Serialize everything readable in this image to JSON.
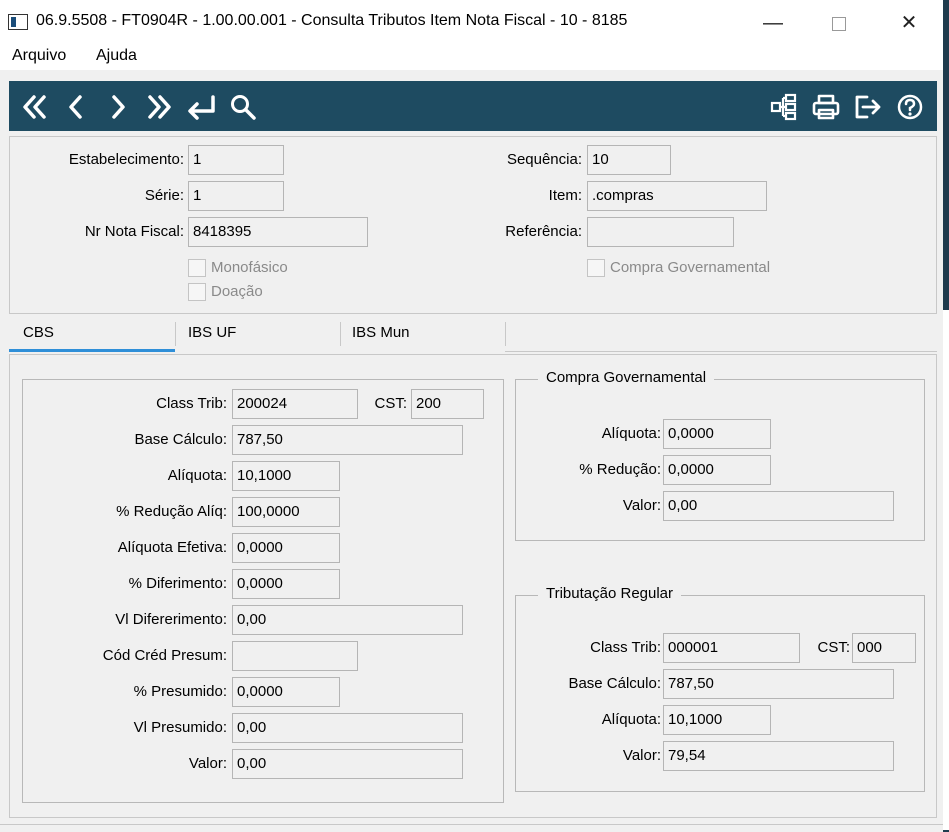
{
  "window": {
    "title": "06.9.5508 - FT0904R - 1.00.00.001 - Consulta Tributos Item Nota Fiscal - 10 - 8185",
    "minimize_glyph": "—",
    "close_glyph": "✕"
  },
  "menu": {
    "items": [
      "Arquivo",
      "Ajuda"
    ]
  },
  "toolbar": {
    "icons": [
      "first-icon",
      "previous-icon",
      "next-icon",
      "last-icon",
      "goto-icon",
      "search-icon",
      "structure-icon",
      "print-icon",
      "exit-icon",
      "help-icon"
    ]
  },
  "header": {
    "estabelecimento": {
      "label": "Estabelecimento:",
      "value": "1"
    },
    "serie": {
      "label": "Série:",
      "value": "1"
    },
    "nr_nota_fiscal": {
      "label": "Nr Nota Fiscal:",
      "value": "8418395"
    },
    "sequencia": {
      "label": "Sequência:",
      "value": "10"
    },
    "item": {
      "label": "Item:",
      "value": ".compras"
    },
    "referencia": {
      "label": "Referência:",
      "value": ""
    },
    "monofasico": {
      "label": "Monofásico",
      "checked": false
    },
    "doacao": {
      "label": "Doação",
      "checked": false
    },
    "compra_governamental": {
      "label": "Compra Governamental",
      "checked": false
    }
  },
  "tabs": [
    {
      "label": "CBS",
      "active": true
    },
    {
      "label": "IBS UF",
      "active": false
    },
    {
      "label": "IBS Mun",
      "active": false
    }
  ],
  "cbs": {
    "class_trib": {
      "label": "Class Trib:",
      "value": "200024"
    },
    "cst": {
      "label": "CST:",
      "value": "200"
    },
    "base_calculo": {
      "label": "Base Cálculo:",
      "value": "787,50"
    },
    "aliquota": {
      "label": "Alíquota:",
      "value": "10,1000"
    },
    "reducao_aliq": {
      "label": "% Redução Alíq:",
      "value": "100,0000"
    },
    "aliquota_efetiva": {
      "label": "Alíquota Efetiva:",
      "value": "0,0000"
    },
    "diferimento": {
      "label": "% Diferimento:",
      "value": "0,0000"
    },
    "vl_diferimento": {
      "label": "Vl Difererimento:",
      "value": "0,00"
    },
    "cod_cred_presum": {
      "label": "Cód Créd Presum:",
      "value": ""
    },
    "presumido": {
      "label": "% Presumido:",
      "value": "0,0000"
    },
    "vl_presumido": {
      "label": "Vl Presumido:",
      "value": "0,00"
    },
    "valor": {
      "label": "Valor:",
      "value": "0,00"
    }
  },
  "compra_governamental_group": {
    "title": "Compra Governamental",
    "aliquota": {
      "label": "Alíquota:",
      "value": "0,0000"
    },
    "reducao": {
      "label": "% Redução:",
      "value": "0,0000"
    },
    "valor": {
      "label": "Valor:",
      "value": "0,00"
    }
  },
  "tributacao_regular": {
    "title": "Tributação Regular",
    "class_trib": {
      "label": "Class Trib:",
      "value": "000001"
    },
    "cst": {
      "label": "CST:",
      "value": "000"
    },
    "base_calculo": {
      "label": "Base Cálculo:",
      "value": "787,50"
    },
    "aliquota": {
      "label": "Alíquota:",
      "value": "10,1000"
    },
    "valor": {
      "label": "Valor:",
      "value": "79,54"
    }
  },
  "colors": {
    "toolbar_bg": "#1e4b61",
    "tab_active": "#2f8fd8",
    "panel_bg": "#f0f0f0"
  }
}
